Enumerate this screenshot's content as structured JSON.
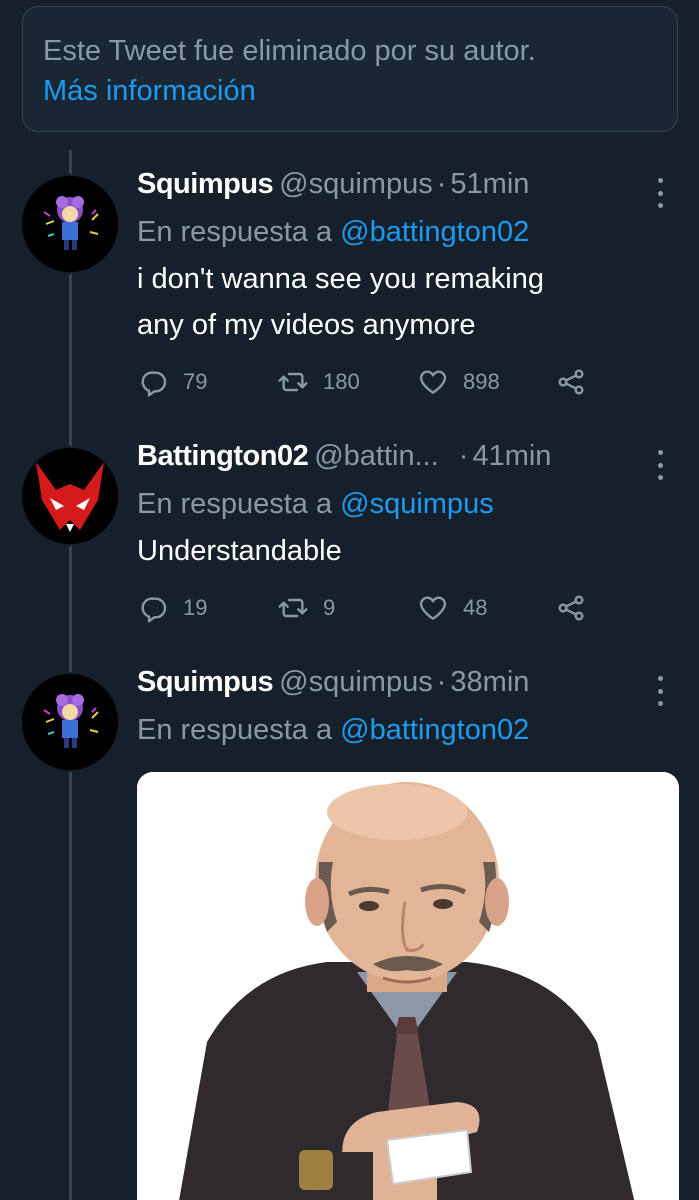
{
  "deleted_notice": {
    "text": "Este Tweet fue eliminado por su autor.",
    "link": "Más información"
  },
  "tweets": [
    {
      "display_name": "Squimpus",
      "handle": "@squimpus",
      "separator": "·",
      "time": "51min",
      "reply_prefix": "En respuesta a",
      "reply_to": "@battington02",
      "body_line1": "i don't wanna see you remaking",
      "body_line2": "any of my videos anymore",
      "replies": "79",
      "retweets": "180",
      "likes": "898"
    },
    {
      "display_name": "Battington02",
      "handle": "@battin...",
      "separator": "·",
      "time": "41min",
      "reply_prefix": "En respuesta a",
      "reply_to": "@squimpus",
      "body_line1": "Understandable",
      "replies": "19",
      "retweets": "9",
      "likes": "48"
    },
    {
      "display_name": "Squimpus",
      "handle": "@squimpus",
      "separator": "·",
      "time": "38min",
      "reply_prefix": "En respuesta a",
      "reply_to": "@battington02"
    }
  ],
  "colors": {
    "background": "#15202b",
    "text_secondary": "#8899a6",
    "link": "#1d9bf0",
    "border": "#38444d"
  },
  "icons": [
    "reply-icon",
    "retweet-icon",
    "like-icon",
    "share-icon",
    "more-icon"
  ]
}
